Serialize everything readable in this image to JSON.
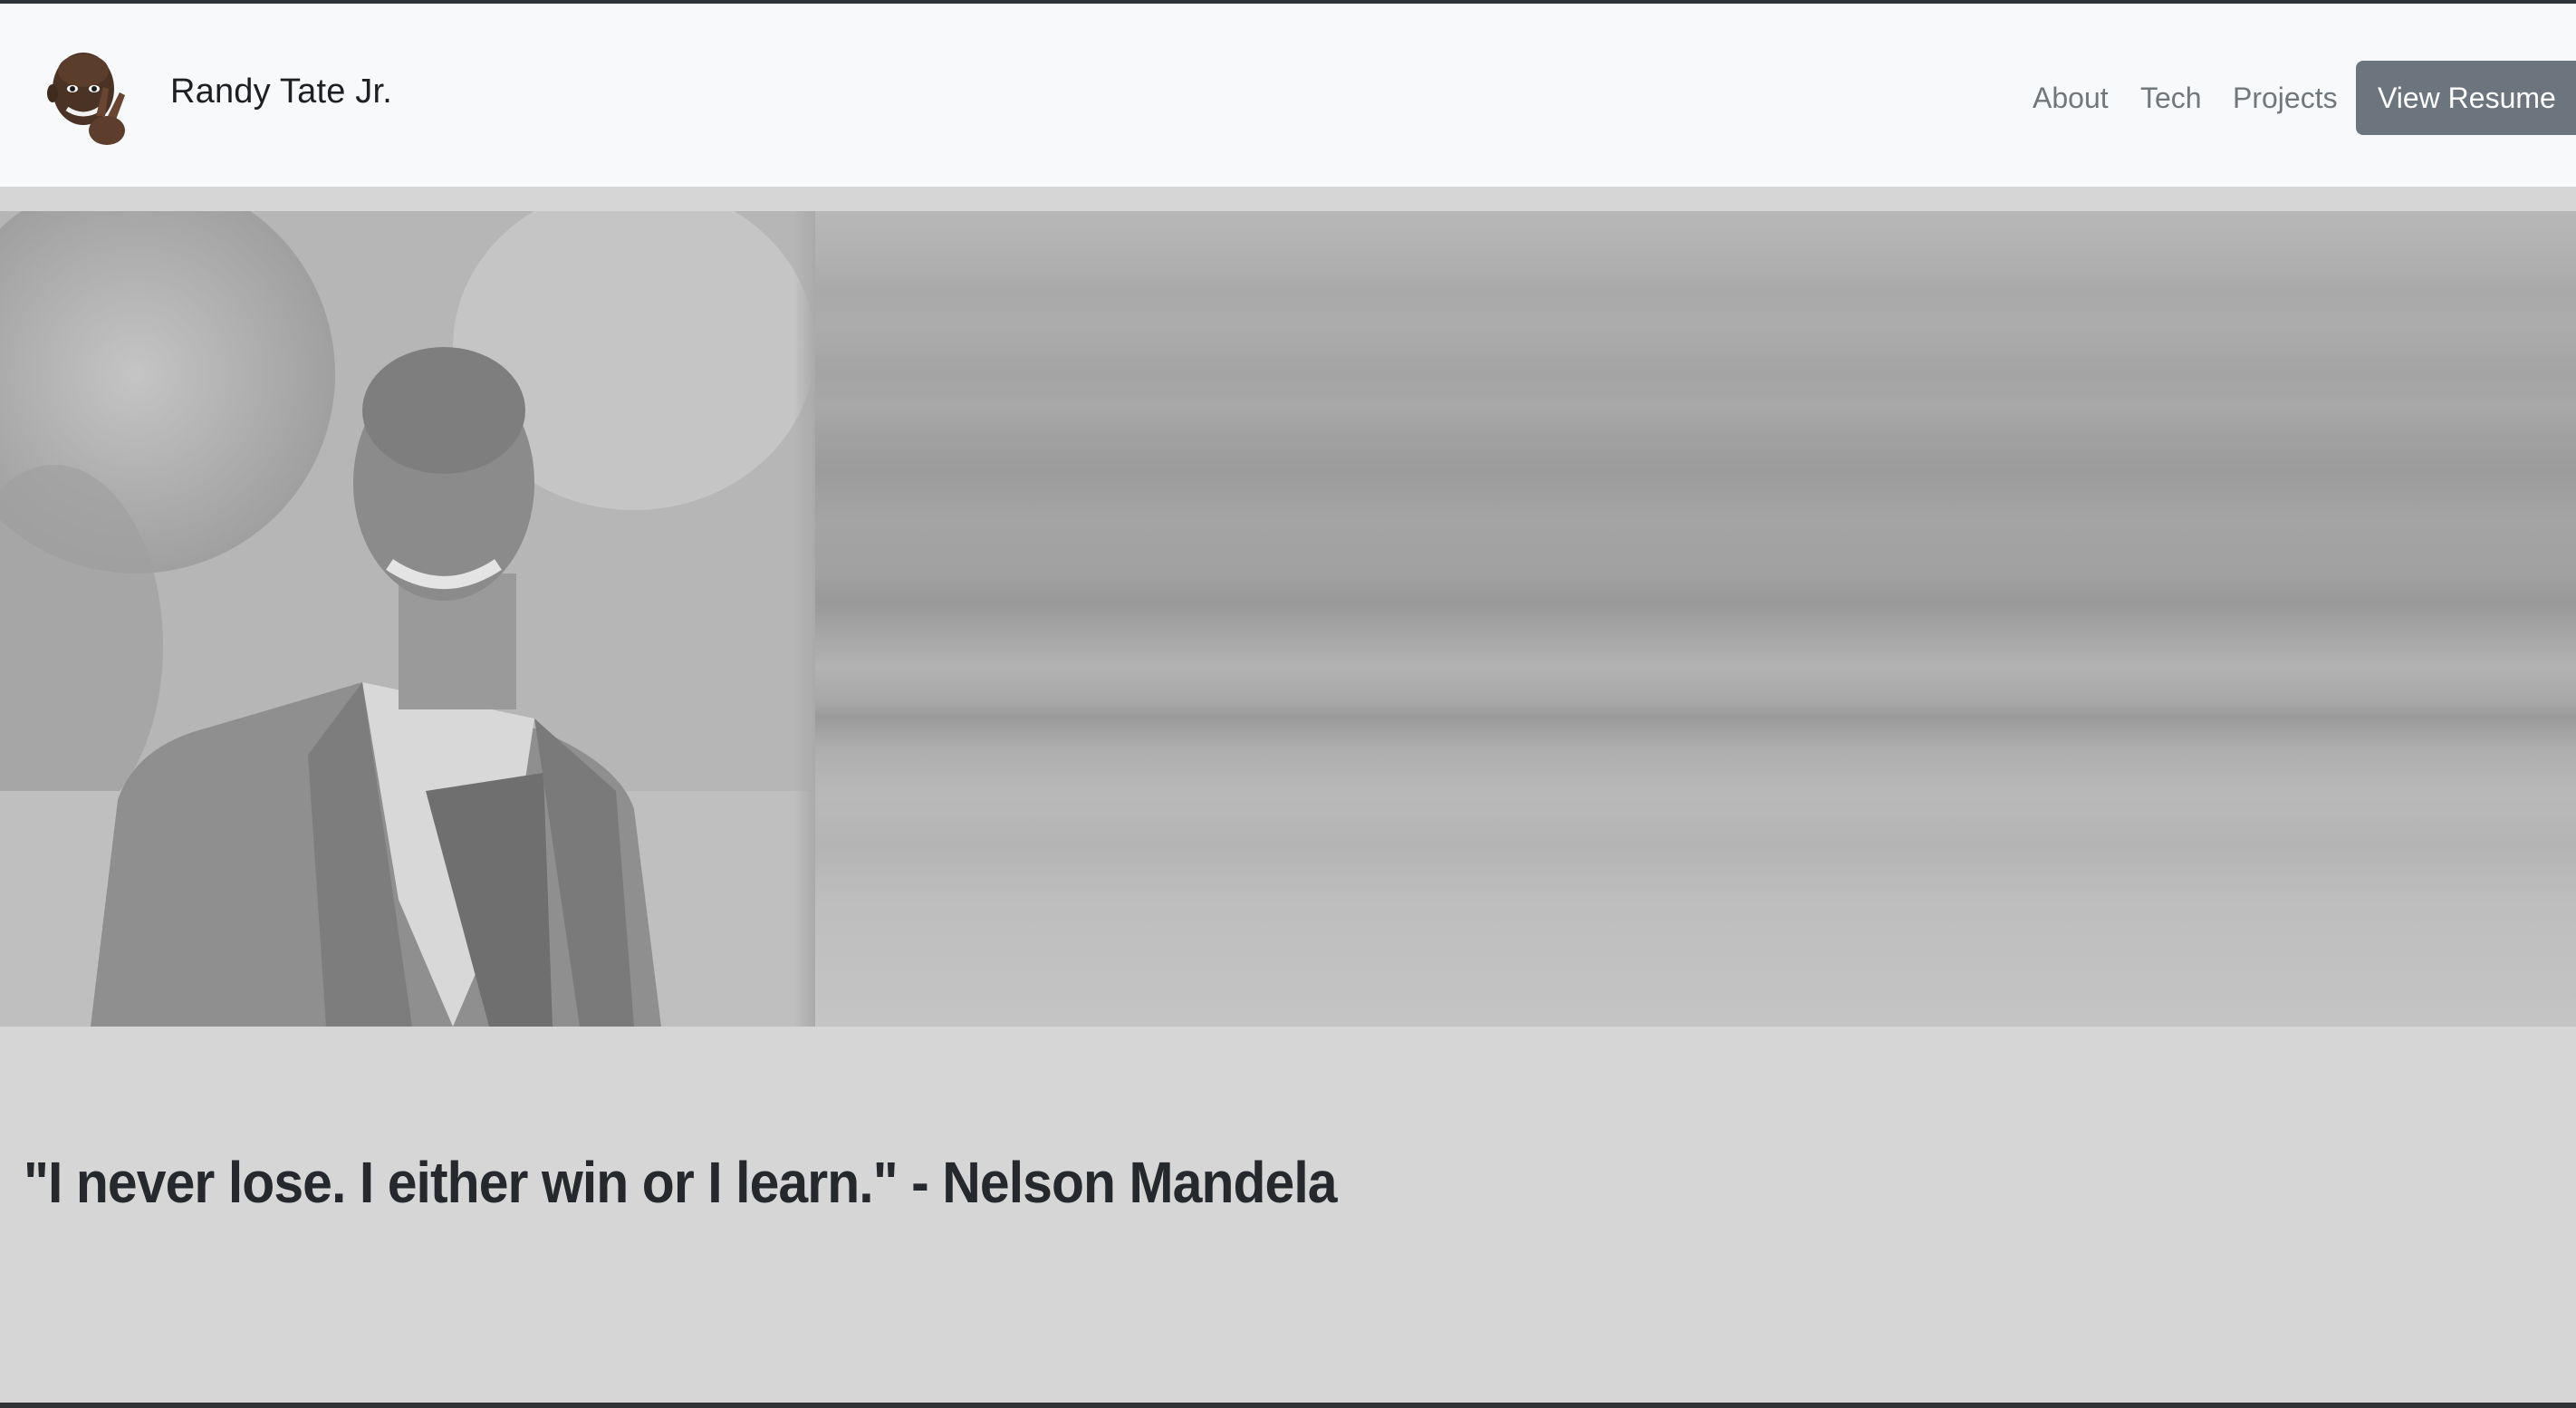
{
  "brand": {
    "name": "Randy Tate Jr.",
    "avatar_icon": "memoji-peace-sign-icon"
  },
  "nav": {
    "links": [
      {
        "label": "About"
      },
      {
        "label": "Tech"
      },
      {
        "label": "Projects"
      }
    ],
    "resume_button": "View Resume"
  },
  "hero": {
    "photo": "portrait-in-suit-image"
  },
  "quote": {
    "text": "\"I never lose. I either win or I learn.\" - Nelson Mandela"
  },
  "colors": {
    "navbar_bg": "#f8f9fa",
    "page_bg": "#d6d6d6",
    "button_bg": "#6c757d",
    "nav_link": "#72777c",
    "quote_text": "#25282c"
  }
}
